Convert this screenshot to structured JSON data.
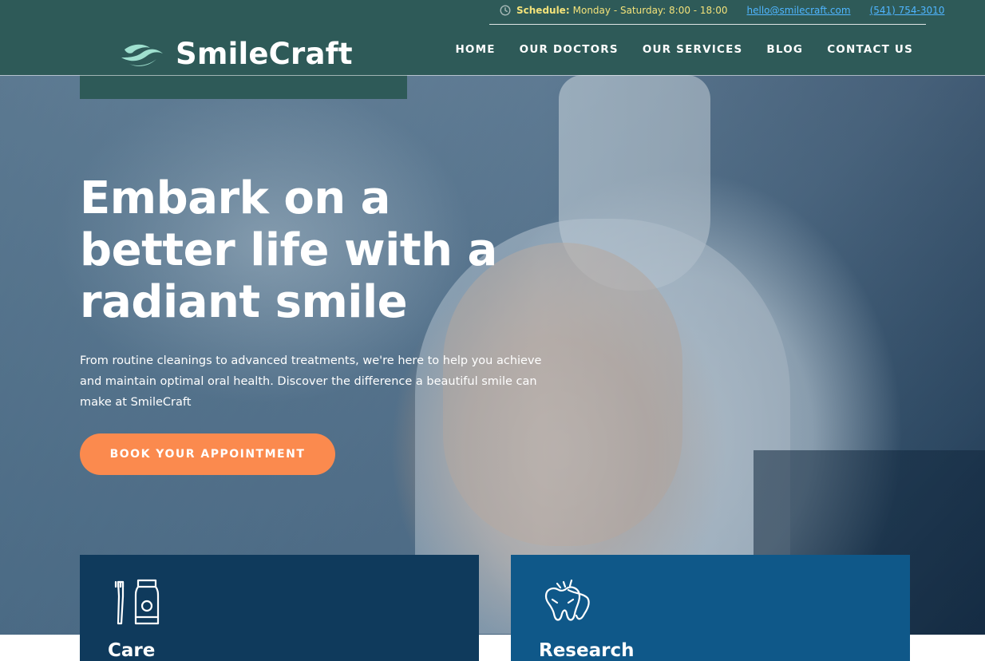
{
  "brand": {
    "name": "SmileCraft",
    "logo_icon": "smile-wave-icon"
  },
  "topbar": {
    "schedule_label": "Schedule:",
    "schedule_hours": "Monday - Saturday: 8:00 - 18:00",
    "email": "hello@smilecraft.com",
    "phone": "(541) 754-3010",
    "icon": "clock-icon"
  },
  "nav": {
    "items": [
      {
        "label": "HOME"
      },
      {
        "label": "OUR DOCTORS"
      },
      {
        "label": "OUR SERVICES"
      },
      {
        "label": "BLOG"
      },
      {
        "label": "CONTACT US"
      }
    ]
  },
  "hero": {
    "title_line1": "Embark on a",
    "title_line2": "better life with a",
    "title_line3": "radiant smile",
    "description": "From routine cleanings to advanced treatments, we're here to help you achieve and maintain optimal oral health. Discover the difference a beautiful smile can make at SmileCraft",
    "cta_label": "BOOK YOUR APPOINTMENT"
  },
  "cards": [
    {
      "title": "Care",
      "icon": "toothbrush-toothpaste-icon"
    },
    {
      "title": "Research",
      "icon": "tooth-research-icon"
    }
  ],
  "colors": {
    "header_bg": "#2e5a58",
    "accent_orange": "#fb8a4e",
    "schedule_yellow": "#f3e27a",
    "link_blue": "#4fb5ff",
    "card_care_bg": "#0f3a5c",
    "card_research_bg": "#0f5889"
  }
}
